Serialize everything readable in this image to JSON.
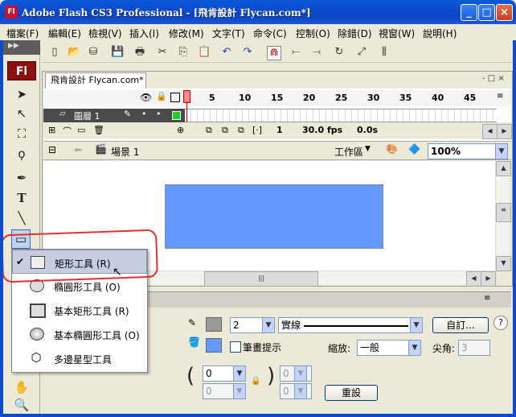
{
  "window": {
    "title": "Adobe Flash CS3 Professional - [飛肯設計  Flycan.com*]",
    "icon_label": "Fl",
    "controls": [
      "_",
      "□",
      "×"
    ]
  },
  "menubar": {
    "items": [
      "檔案(F)",
      "編輯(E)",
      "檢視(V)",
      "插入(I)",
      "修改(M)",
      "文字(T)",
      "命令(C)",
      "控制(O)",
      "除錯(D)",
      "視窗(W)",
      "說明(H)"
    ]
  },
  "tools": {
    "logo": "Fl",
    "icons": [
      "arrow-icon",
      "subselect-icon",
      "free-transform-icon",
      "lasso-icon",
      "pen-icon",
      "text-icon",
      "line-icon",
      "rectangle-icon",
      "hand-icon",
      "zoom-icon"
    ]
  },
  "document": {
    "tab_label": "飛肯設計  Flycan.com*",
    "tab_controls": "-  □  ×"
  },
  "timeline": {
    "frame_numbers": [
      "1",
      "5",
      "10",
      "15",
      "20",
      "25",
      "30",
      "35",
      "40",
      "45"
    ],
    "layer_name": "圖層 1",
    "current_frame": "1",
    "fps": "30.0 fps",
    "time": "0.0s"
  },
  "editbar": {
    "scene": "場景 1",
    "workspace": "工作區",
    "zoom": "100%"
  },
  "colors": {
    "stage_rect": "#6699ff",
    "fill": "#6699ff",
    "stroke": "#999999"
  },
  "properties": {
    "stroke_width": "2",
    "stroke_style": "實線",
    "custom_button": "自訂...",
    "hinting_label": "筆畫提示",
    "scale_label": "縮放:",
    "scale_value": "一般",
    "miter_label": "尖角:",
    "miter_value": "3",
    "corner_radius": "0",
    "corner_radius_2": "0",
    "corner_radius_3": "0",
    "corner_radius_4": "0",
    "reset_button": "重設",
    "help_icon": "?"
  },
  "flyout": {
    "items": [
      {
        "label": "矩形工具 (R)",
        "checked": true
      },
      {
        "label": "橢圓形工具 (O)",
        "checked": false
      },
      {
        "label": "基本矩形工具 (R)",
        "checked": false
      },
      {
        "label": "基本橢圓形工具 (O)",
        "checked": false
      },
      {
        "label": "多邊星型工具",
        "checked": false
      }
    ],
    "check": "✔"
  }
}
